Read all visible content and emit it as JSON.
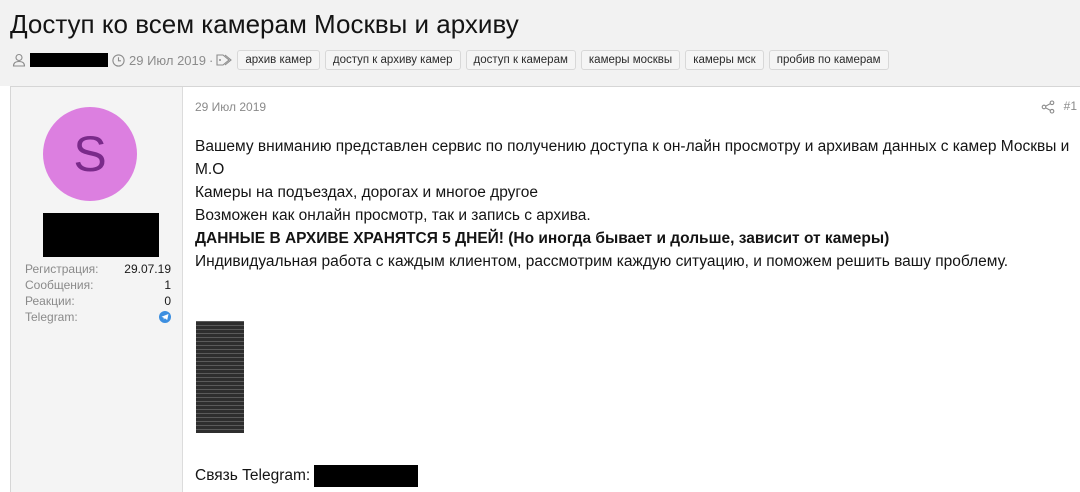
{
  "thread": {
    "title": "Доступ ко всем камерам Москвы и архиву",
    "date": "29 Июл 2019",
    "date_separator": "·",
    "tags": [
      "архив камер",
      "доступ к архиву камер",
      "доступ к камерам",
      "камеры москвы",
      "камеры мск",
      "пробив по камерам"
    ]
  },
  "user": {
    "avatar_letter": "S",
    "avatar_color": "#dc7fe0",
    "stats": [
      {
        "label": "Регистрация:",
        "value": "29.07.19"
      },
      {
        "label": "Сообщения:",
        "value": "1"
      },
      {
        "label": "Реакции:",
        "value": "0"
      },
      {
        "label": "Telegram:",
        "value": ""
      }
    ]
  },
  "post": {
    "date": "29 Июл 2019",
    "number": "#1",
    "paragraphs": [
      "Вашему вниманию представлен сервис по получению доступа к он-лайн просмотру и архивам данных с камер Москвы и М.О",
      "Камеры на подъездах, дорогах и многое другое",
      "Возможен как онлайн просмотр, так и запись с архива."
    ],
    "bold_line": "ДАННЫЕ В АРХИВЕ ХРАНЯТСЯ 5 ДНЕЙ! (Но иногда бывает и дольше, зависит от камеры)",
    "last_paragraph": "Индивидуальная работа с каждым клиентом, рассмотрим каждую ситуацию, и поможем решить вашу проблему.",
    "contact_label": "Связь Telegram:"
  },
  "icons": {
    "user": "user-icon",
    "clock": "clock-icon",
    "tag": "tag-icon",
    "share": "share-icon",
    "telegram": "telegram-icon"
  }
}
